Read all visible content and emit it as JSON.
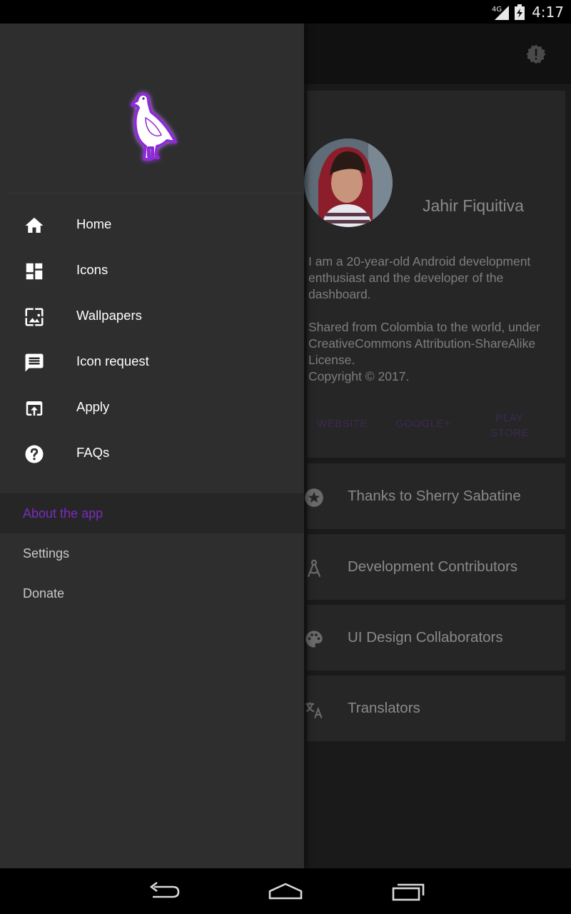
{
  "status_bar": {
    "network_label": "4G",
    "time": "4:17"
  },
  "background": {
    "profile": {
      "name": "Jahir Fiquitiva",
      "bio_paragraph_1": "I am a 20-year-old Android development enthusiast and the developer of the dashboard.",
      "bio_paragraph_2": "Shared from Colombia to the world, under CreativeCommons Attribution-ShareAlike License.",
      "bio_paragraph_3": "Copyright © 2017.",
      "links": [
        "WEBSITE",
        "GOOGLE+",
        "PLAY STORE"
      ]
    },
    "rows": [
      {
        "label": "Thanks to Sherry Sabatine",
        "icon": "star-circle-icon"
      },
      {
        "label": "Development Contributors",
        "icon": "compass-icon"
      },
      {
        "label": "UI Design Collaborators",
        "icon": "palette-icon"
      },
      {
        "label": "Translators",
        "icon": "translate-icon"
      }
    ]
  },
  "drawer": {
    "logo": "pigeon-logo",
    "nav_items": [
      {
        "label": "Home",
        "icon": "home-icon"
      },
      {
        "label": "Icons",
        "icon": "dashboard-icon"
      },
      {
        "label": "Wallpapers",
        "icon": "wallpaper-icon"
      },
      {
        "label": "Icon request",
        "icon": "message-icon"
      },
      {
        "label": "Apply",
        "icon": "open-in-browser-icon"
      },
      {
        "label": "FAQs",
        "icon": "help-icon"
      }
    ],
    "secondary_items": [
      {
        "label": "About the app",
        "active": true
      },
      {
        "label": "Settings",
        "active": false
      },
      {
        "label": "Donate",
        "active": false
      }
    ]
  },
  "colors": {
    "accent": "#7b2cbf",
    "drawer_bg": "#2e2e2e",
    "content_bg": "#1a1a1a"
  },
  "system_nav": [
    "back-icon",
    "home-nav-icon",
    "recents-icon"
  ]
}
